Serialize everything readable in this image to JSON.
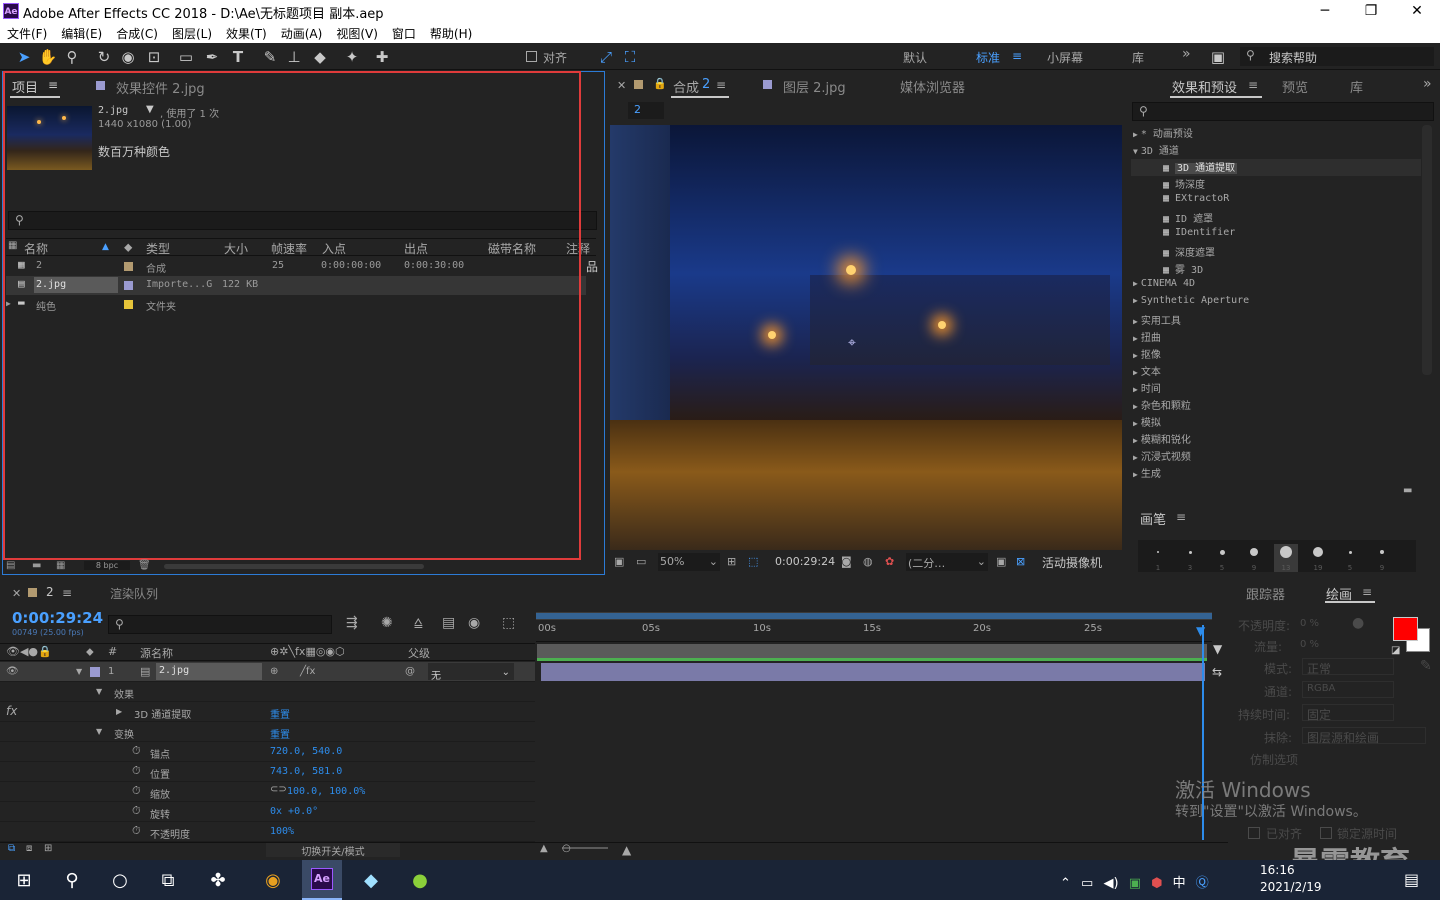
{
  "window": {
    "app_icon": "Ae",
    "title": "Adobe After Effects CC 2018 - D:\\Ae\\无标题项目 副本.aep",
    "min": "─",
    "max": "❐",
    "close": "✕"
  },
  "menu": [
    "文件(F)",
    "编辑(E)",
    "合成(C)",
    "图层(L)",
    "效果(T)",
    "动画(A)",
    "视图(V)",
    "窗口",
    "帮助(H)"
  ],
  "toolbar": {
    "align_label": "对齐",
    "workspaces": [
      "默认",
      "标准",
      "小屏幕",
      "库"
    ],
    "active_workspace": "标准",
    "more": "»",
    "search_placeholder": "搜索帮助"
  },
  "project": {
    "tab_project": "项目",
    "tab_effects": "效果控件 2.jpg",
    "item_name": "2.jpg",
    "item_used": ", 使用了 1 次",
    "item_dims": "1440 x1080 (1.00)",
    "item_colors": "数百万种颜色",
    "columns": [
      "名称",
      "类型",
      "大小",
      "帧速率",
      "入点",
      "出点",
      "磁带名称",
      "注释"
    ],
    "rows": [
      {
        "name": "2",
        "type": "合成",
        "size": "",
        "fps": "25",
        "in": "0:00:00:00",
        "out": "0:00:30:00",
        "color": "#b29a70"
      },
      {
        "name": "2.jpg",
        "type": "Importe...G",
        "size": "122 KB",
        "fps": "",
        "in": "",
        "out": "",
        "color": "#9a9ad0"
      },
      {
        "name": "纯色",
        "type": "文件夹",
        "size": "",
        "fps": "",
        "in": "",
        "out": "",
        "color": "#e6c43a"
      }
    ],
    "bpc": "8 bpc"
  },
  "composition": {
    "tab_comp": "合成",
    "tab_comp_name": "2",
    "tab_layer": "图层 2.jpg",
    "tab_media": "媒体浏览器",
    "breadcrumb": "2",
    "zoom": "50%",
    "timecode": "0:00:29:24",
    "resolution": "(二分…",
    "camera": "活动摄像机"
  },
  "effects": {
    "tab_effects": "效果和预设",
    "tab_preview": "预览",
    "tab_library": "库",
    "items": [
      {
        "label": "* 动画预设",
        "level": 0,
        "open": false
      },
      {
        "label": "3D 通道",
        "level": 0,
        "open": true
      },
      {
        "label": "3D 通道提取",
        "level": 1,
        "selected": true
      },
      {
        "label": "场深度",
        "level": 1
      },
      {
        "label": "EXtractoR",
        "level": 1
      },
      {
        "label": "ID 遮罩",
        "level": 1
      },
      {
        "label": "IDentifier",
        "level": 1
      },
      {
        "label": "深度遮罩",
        "level": 1
      },
      {
        "label": "雾 3D",
        "level": 1
      },
      {
        "label": "CINEMA 4D",
        "level": 0
      },
      {
        "label": "Synthetic Aperture",
        "level": 0
      },
      {
        "label": "实用工具",
        "level": 0
      },
      {
        "label": "扭曲",
        "level": 0
      },
      {
        "label": "抠像",
        "level": 0
      },
      {
        "label": "文本",
        "level": 0
      },
      {
        "label": "时间",
        "level": 0
      },
      {
        "label": "杂色和颗粒",
        "level": 0
      },
      {
        "label": "模拟",
        "level": 0
      },
      {
        "label": "模糊和锐化",
        "level": 0
      },
      {
        "label": "沉浸式视频",
        "level": 0
      },
      {
        "label": "生成",
        "level": 0
      }
    ],
    "brush_title": "画笔",
    "brush_sizes": [
      "1",
      "3",
      "5",
      "9",
      "13",
      "19",
      "5",
      "9"
    ]
  },
  "timeline": {
    "tab_comp": "2",
    "tab_render": "渲染队列",
    "timecode": "0:00:29:24",
    "frames": "00749 (25.00 fps)",
    "col_source": "源名称",
    "col_parent": "父级",
    "layer_num": "1",
    "layer_name": "2.jpg",
    "parent_value": "无",
    "effects_label": "效果",
    "effect_name": "3D 通道提取",
    "reset": "重置",
    "transform": "变换",
    "props": [
      {
        "name": "锚点",
        "value": "720.0, 540.0"
      },
      {
        "name": "位置",
        "value": "743.0, 581.0"
      },
      {
        "name": "缩放",
        "value": "100.0, 100.0%"
      },
      {
        "name": "旋转",
        "value": "0x +0.0°"
      },
      {
        "name": "不透明度",
        "value": "100%"
      }
    ],
    "ruler": [
      "00s",
      "05s",
      "10s",
      "15s",
      "20s",
      "25s"
    ],
    "toggle_label": "切换开关/模式"
  },
  "paint": {
    "tab_tracker": "跟踪器",
    "tab_paint": "绘画",
    "opacity_label": "不透明度:",
    "opacity_value": "0 %",
    "flow_label": "流量:",
    "flow_value": "0 %",
    "mode_label": "模式:",
    "mode_value": "正常",
    "channel_label": "通道:",
    "channel_value": "RGBA",
    "duration_label": "持续时间:",
    "duration_value": "固定",
    "erase_label": "抹除:",
    "erase_value": "图层源和绘画",
    "clone_label": "仿制选项",
    "aligned": "已对齐",
    "lock_source": "锁定源时间",
    "fg_color": "#ff0000",
    "bg_color": "#ffffff"
  },
  "watermark": {
    "line1": "激活 Windows",
    "line2": "转到\"设置\"以激活 Windows。",
    "brand": "暴需教育"
  },
  "taskbar": {
    "time": "16:16",
    "date": "2021/2/19",
    "ime": "中"
  }
}
